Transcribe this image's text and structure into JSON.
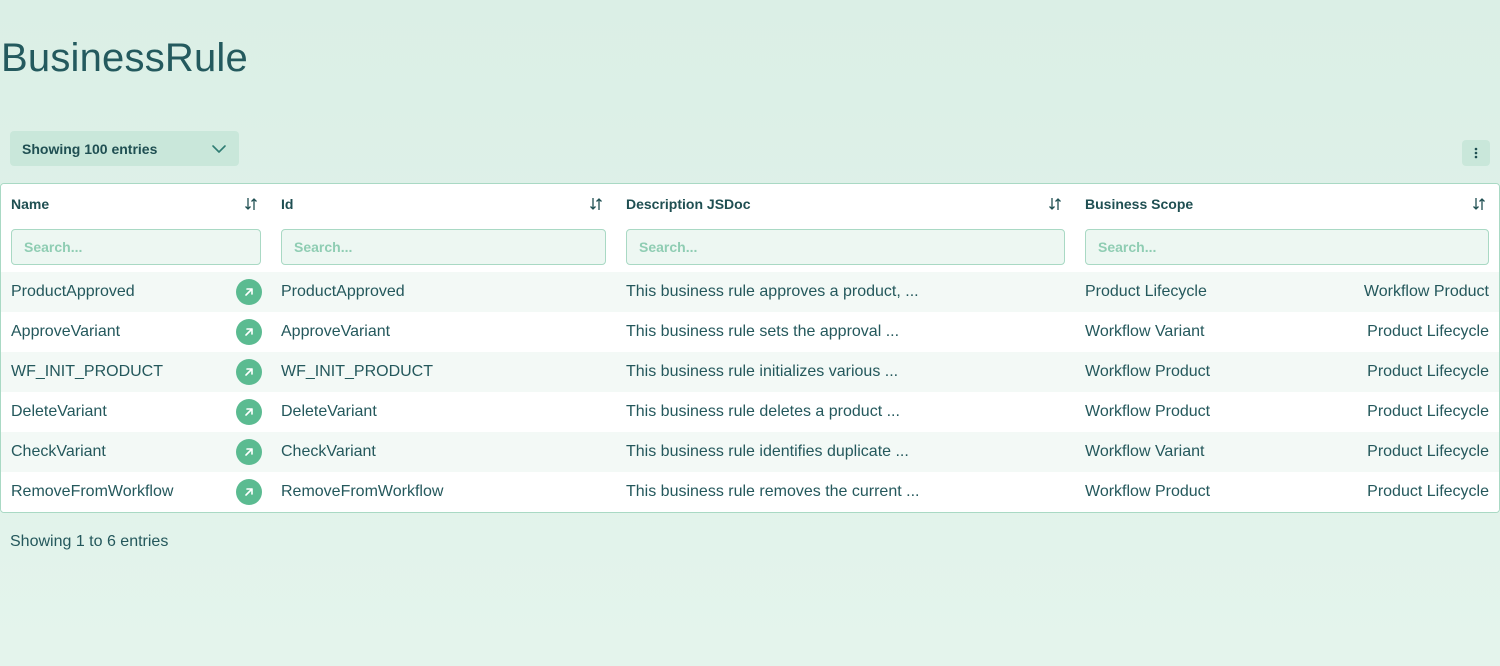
{
  "page": {
    "title": "BusinessRule"
  },
  "toolbar": {
    "entries_label": "Showing 100 entries",
    "chevron_icon": "chevron-down-icon",
    "more_icon": "kebab-menu-icon"
  },
  "table": {
    "columns": [
      {
        "title": "Name",
        "search_placeholder": "Search..."
      },
      {
        "title": "Id",
        "search_placeholder": "Search..."
      },
      {
        "title": "Description JSDoc",
        "search_placeholder": "Search..."
      },
      {
        "title": "Business Scope",
        "search_placeholder": "Search..."
      }
    ],
    "rows": [
      {
        "name": "ProductApproved",
        "id": "ProductApproved",
        "description": "This business rule approves a product, ...",
        "scope_primary": "Product Lifecycle",
        "scope_secondary": "Workflow Product"
      },
      {
        "name": "ApproveVariant",
        "id": "ApproveVariant",
        "description": "This business rule sets the approval ...",
        "scope_primary": "Workflow Variant",
        "scope_secondary": "Product Lifecycle"
      },
      {
        "name": "WF_INIT_PRODUCT",
        "id": "WF_INIT_PRODUCT",
        "description": "This business rule initializes various ...",
        "scope_primary": "Workflow Product",
        "scope_secondary": "Product Lifecycle"
      },
      {
        "name": "DeleteVariant",
        "id": "DeleteVariant",
        "description": "This business rule deletes a product ...",
        "scope_primary": "Workflow Product",
        "scope_secondary": "Product Lifecycle"
      },
      {
        "name": "CheckVariant",
        "id": "CheckVariant",
        "description": "This business rule identifies duplicate ...",
        "scope_primary": "Workflow Variant",
        "scope_secondary": "Product Lifecycle"
      },
      {
        "name": "RemoveFromWorkflow",
        "id": "RemoveFromWorkflow",
        "description": "This business rule removes the current ...",
        "scope_primary": "Workflow Product",
        "scope_secondary": "Product Lifecycle"
      }
    ],
    "row_icon": "arrow-up-right-icon",
    "sort_icon": "sort-arrows-icon"
  },
  "footer": {
    "info": "Showing 1 to 6 entries"
  },
  "colors": {
    "background": "#dbefe6",
    "accent": "#5bbb91",
    "text": "#1f4f52",
    "border": "#a9d9c4"
  }
}
